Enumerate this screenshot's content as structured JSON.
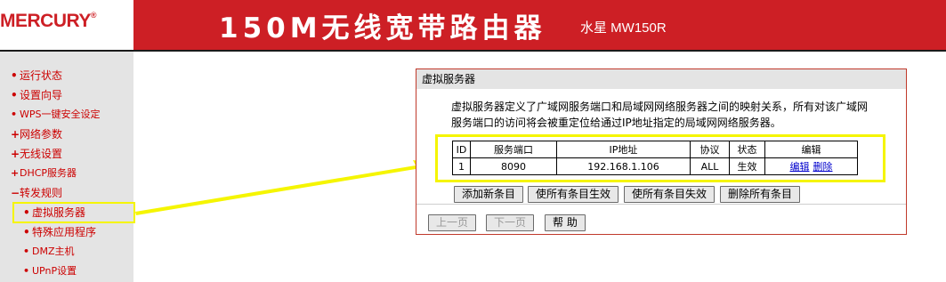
{
  "header": {
    "logo": "MERCURY",
    "logo_mark": "®",
    "product_title": "150M无线宽带路由器",
    "product_subtitle": "水星 MW150R",
    "brand_color": "#cd1f25"
  },
  "sidebar": {
    "items": [
      {
        "bullet": "•",
        "label": "运行状态"
      },
      {
        "bullet": "•",
        "label": "设置向导"
      },
      {
        "bullet": "•",
        "label": "WPS一键安全设定"
      },
      {
        "bullet": "+",
        "label": "网络参数"
      },
      {
        "bullet": "+",
        "label": "无线设置"
      },
      {
        "bullet": "+",
        "label": "DHCP服务器"
      },
      {
        "bullet": "−",
        "label": "转发规则"
      },
      {
        "bullet": "•",
        "label": "虚拟服务器",
        "selected": true
      },
      {
        "bullet": "•",
        "label": "特殊应用程序"
      },
      {
        "bullet": "•",
        "label": "DMZ主机"
      },
      {
        "bullet": "•",
        "label": "UPnP设置"
      }
    ]
  },
  "panel": {
    "title": "虚拟服务器",
    "description_line1": "虚拟服务器定义了广域网服务端口和局域网网络服务器之间的映射关系，所有对该广域网",
    "description_line2": "服务端口的访问将会被重定位给通过IP地址指定的局域网网络服务器。",
    "table": {
      "headers": [
        "ID",
        "服务端口",
        "IP地址",
        "协议",
        "状态",
        "编辑"
      ],
      "rows": [
        {
          "id": "1",
          "port": "8090",
          "ip": "192.168.1.106",
          "protocol": "ALL",
          "status": "生效",
          "edit": "编辑",
          "delete": "删除"
        }
      ]
    },
    "buttons": {
      "add": "添加新条目",
      "enable_all": "使所有条目生效",
      "disable_all": "使所有条目失效",
      "delete_all": "删除所有条目"
    },
    "nav": {
      "prev": "上一页",
      "next": "下一页",
      "help": "帮 助"
    }
  },
  "highlight_color": "#f5f500"
}
